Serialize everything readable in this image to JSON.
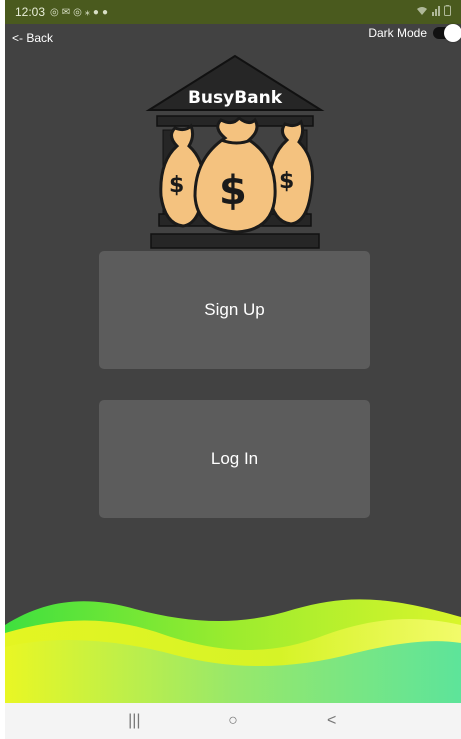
{
  "status_bar": {
    "time": "12:03",
    "icons": [
      "whatsapp-icon",
      "mail-icon",
      "whatsapp-icon",
      "signal-icon",
      "android-icon",
      "dot-icon"
    ],
    "right_icons": [
      "wifi-icon",
      "signal-bars-icon",
      "battery-icon"
    ]
  },
  "header": {
    "back_label": "<- Back",
    "dark_mode_label": "Dark Mode",
    "dark_mode_on": true
  },
  "logo": {
    "text": "BusyBank"
  },
  "buttons": {
    "signup_label": "Sign Up",
    "login_label": "Log In"
  },
  "nav": {
    "recents_glyph": "|||",
    "home_glyph": "○",
    "back_glyph": "<"
  },
  "colors": {
    "background": "#424242",
    "button": "#5c5c5c",
    "status_bar": "#4a5a1e",
    "wave_green": "#3fe03f",
    "wave_yellow": "#e6f52a"
  }
}
